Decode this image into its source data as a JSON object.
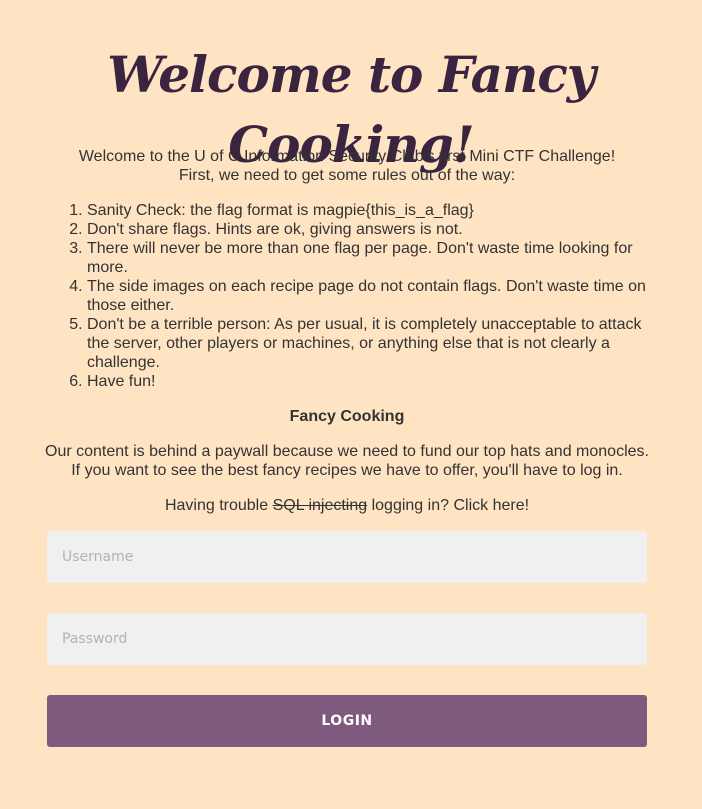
{
  "header": {
    "title": "Welcome to Fancy Cooking!"
  },
  "intro": {
    "line1": "Welcome to the U of C Information Security Club's first Mini CTF Challenge!",
    "line2": "First, we need to get some rules out of the way:"
  },
  "rules": [
    "Sanity Check: the flag format is magpie{this_is_a_flag}",
    "Don't share flags. Hints are ok, giving answers is not.",
    "There will never be more than one flag per page. Don't waste time looking for more.",
    "The side images on each recipe page do not contain flags. Don't waste time on those either.",
    "Don't be a terrible person: As per usual, it is completely unacceptable to attack the server, other players or machines, or anything else that is not clearly a challenge.",
    "Have fun!"
  ],
  "section": {
    "heading": "Fancy Cooking",
    "paywall_line1": "Our content is behind a paywall because we need to fund our top hats and monocles.",
    "paywall_line2": "If you want to see the best fancy recipes we have to offer, you'll have to log in."
  },
  "trouble": {
    "prefix": "Having trouble ",
    "struck": "SQL injecting",
    "middle": " logging in? ",
    "link": "Click here!"
  },
  "form": {
    "username_placeholder": "Username",
    "username_value": "",
    "password_placeholder": "Password",
    "password_value": "",
    "login_label": "LOGIN"
  },
  "colors": {
    "background": "#ffe4c4",
    "title": "#3a2440",
    "button": "#7d5a7e",
    "input_bg": "#f0f0f0"
  }
}
